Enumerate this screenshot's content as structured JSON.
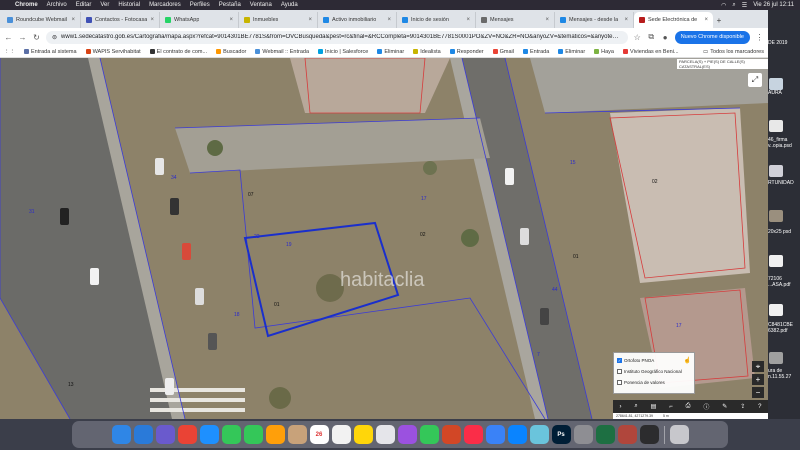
{
  "menubar": {
    "app": "Chrome",
    "items": [
      "Archivo",
      "Editar",
      "Ver",
      "Historial",
      "Marcadores",
      "Perfiles",
      "Pestaña",
      "Ventana",
      "Ayuda"
    ],
    "datetime": "Vie 26 jul 12:11"
  },
  "tabs": [
    {
      "title": "Roundcube Webmail",
      "color": "#4a90d9"
    },
    {
      "title": "Contactos - Fotocasa",
      "color": "#3f51b5"
    },
    {
      "title": "WhatsApp",
      "color": "#25d366"
    },
    {
      "title": "Inmuebles",
      "color": "#c7b400"
    },
    {
      "title": "Activo inmobiliario",
      "color": "#1e88e5"
    },
    {
      "title": "Inicio de sesión",
      "color": "#1e88e5"
    },
    {
      "title": "Mensajes",
      "color": "#6a6a6a"
    },
    {
      "title": "Mensajes - desde la",
      "color": "#1e88e5"
    },
    {
      "title": "Sede Electrónica de",
      "color": "#b71c1c"
    }
  ],
  "toolbar": {
    "url": "www1.sedecatastro.gob.es/Cartografia/mapa.aspx?refcat=9014301BE7781S&from=OVCBusqueda&pest=rc&final=&RCCompleta=9014301BE7781S0001PO&ZV=NO&ZR=NO&anyoZV=&tematicos=&anyotem=...",
    "update_label": "Nuevo Chrome disponible"
  },
  "bookmarks": [
    {
      "label": "Entrada al sistema",
      "color": "#5b6fa6"
    },
    {
      "label": "WAPIS Servihabitat",
      "color": "#d84315"
    },
    {
      "label": "El contrato de com...",
      "color": "#333333"
    },
    {
      "label": "Buscador",
      "color": "#ff9800"
    },
    {
      "label": "Webmail :: Entrada",
      "color": "#4a90d9"
    },
    {
      "label": "Inicio | Salesforce",
      "color": "#00a1e0"
    },
    {
      "label": "Eliminar",
      "color": "#1e88e5"
    },
    {
      "label": "Idealista",
      "color": "#c7b400"
    },
    {
      "label": "Responder",
      "color": "#1e88e5"
    },
    {
      "label": "Gmail",
      "color": "#ea4335"
    },
    {
      "label": "Entrada",
      "color": "#1e88e5"
    },
    {
      "label": "Eliminar",
      "color": "#1e88e5"
    },
    {
      "label": "Haya",
      "color": "#7cb342"
    },
    {
      "label": "Viviendas en Beni...",
      "color": "#e53935"
    }
  ],
  "bookmarks_all": "Todos los marcadores",
  "map": {
    "tooltip": "PARCELA(S) + PIE(S) DE CALLE(S) CATASTRAL(ES)",
    "watermark": "habitaclia",
    "parcel_labels": [
      "01",
      "02",
      "07",
      "13",
      "02",
      "01",
      "03",
      "19",
      "22",
      "17",
      "15",
      "34",
      "44",
      "31",
      "18",
      "7",
      "17"
    ],
    "layers": [
      {
        "label": "Ortofoto PNOA",
        "checked": true
      },
      {
        "label": "Instituto Geográfico Nacional",
        "checked": false
      },
      {
        "label": "Ponencia de valores",
        "checked": false
      }
    ],
    "coords": [
      "278641.81, 4271279.39",
      "5 m"
    ]
  },
  "desktop_files": [
    {
      "label": "DE 2019"
    },
    {
      "label": "AURA"
    },
    {
      "label": "46_firma v..opia.psd"
    },
    {
      "label": "RTUNIDAD"
    },
    {
      "label": "20x25 psd"
    },
    {
      "label": "72106 ...ASA.pdf"
    },
    {
      "label": "C8481CBE 6382.pdf"
    },
    {
      "label": "ura de n.11.55.27"
    }
  ],
  "dock": [
    {
      "name": "Finder",
      "color": "#2f86e6",
      "glyph": ""
    },
    {
      "name": "Mail",
      "color": "#2a7ad9",
      "glyph": ""
    },
    {
      "name": "Launchpad",
      "color": "#6a5acd",
      "glyph": ""
    },
    {
      "name": "Chrome",
      "color": "#ea4335",
      "glyph": ""
    },
    {
      "name": "Safari",
      "color": "#1e90ff",
      "glyph": ""
    },
    {
      "name": "FaceTime",
      "color": "#34c759",
      "glyph": ""
    },
    {
      "name": "Messages",
      "color": "#34c759",
      "glyph": ""
    },
    {
      "name": "Photos",
      "color": "#ff9f0a",
      "glyph": ""
    },
    {
      "name": "Contacts",
      "color": "#c8a27a",
      "glyph": ""
    },
    {
      "name": "Calendar",
      "color": "#ffffff",
      "glyph": "26"
    },
    {
      "name": "Reminders",
      "color": "#f2f2f2",
      "glyph": ""
    },
    {
      "name": "Notes",
      "color": "#ffd60a",
      "glyph": ""
    },
    {
      "name": "Freeform",
      "color": "#e5e5ea",
      "glyph": ""
    },
    {
      "name": "Podcasts",
      "color": "#9b51e0",
      "glyph": ""
    },
    {
      "name": "Numbers",
      "color": "#34c759",
      "glyph": ""
    },
    {
      "name": "PowerPoint",
      "color": "#d24726",
      "glyph": ""
    },
    {
      "name": "Music",
      "color": "#fa2d48",
      "glyph": ""
    },
    {
      "name": "Keynote",
      "color": "#3a82f7",
      "glyph": ""
    },
    {
      "name": "App Store",
      "color": "#0a84ff",
      "glyph": ""
    },
    {
      "name": "Preview",
      "color": "#6ac4dc",
      "glyph": ""
    },
    {
      "name": "Photoshop",
      "color": "#001e36",
      "glyph": "Ps"
    },
    {
      "name": "System Settings",
      "color": "#8e8e93",
      "glyph": ""
    },
    {
      "name": "Excel",
      "color": "#1d6f42",
      "glyph": ""
    },
    {
      "name": "Photo Booth",
      "color": "#b0463c",
      "glyph": ""
    },
    {
      "name": "Screen",
      "color": "#2c2c2e",
      "glyph": ""
    },
    {
      "name": "Trash",
      "color": "#c7c7cc",
      "glyph": ""
    }
  ]
}
